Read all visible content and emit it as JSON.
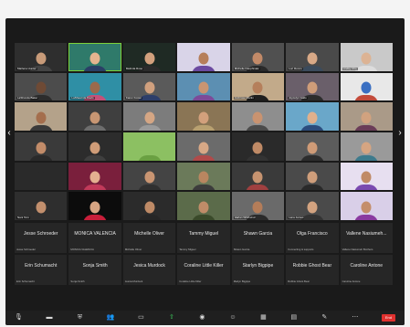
{
  "tiles": [
    {
      "name": "Marlena Hunter",
      "bg": "#2e2e2e",
      "skin": "#c89b79",
      "shirt": "#444444"
    },
    {
      "name": "",
      "bg": "#2f7a6a",
      "skin": "#e5b48f",
      "shirt": "#2a3f66",
      "active": true
    },
    {
      "name": "Melinda Rose",
      "bg": "#1f2a24",
      "skin": "#d2a07d",
      "shirt": "#2b2b2b"
    },
    {
      "name": "",
      "bg": "#d9d4e8",
      "skin": "#b67e5a",
      "shirt": "#6b4aa0"
    },
    {
      "name": "Michelle Dauphinais",
      "bg": "#505050",
      "skin": "#c28a68",
      "shirt": "#2a2a2a"
    },
    {
      "name": "Lori Ronco",
      "bg": "#4a4a4a",
      "skin": "#d8a987",
      "shirt": "#3b4b5c"
    },
    {
      "name": "Lindsy Cho",
      "bg": "#c9c9c9",
      "skin": "#dcb394",
      "shirt": "#dddddd"
    },
    {
      "name": "LaShonda Baker",
      "bg": "#4c4c4c",
      "skin": "#6e4a35",
      "shirt": "#2c2c2c"
    },
    {
      "name": "LaShawnda Davis",
      "bg": "#2f8fa5",
      "skin": "#9a6a4c",
      "shirt": "#c55078"
    },
    {
      "name": "Karen Foster",
      "bg": "#5a5a5a",
      "skin": "#d0a07e",
      "shirt": "#2d3e6a"
    },
    {
      "name": "",
      "bg": "#5c8fb2",
      "skin": "#c99572",
      "shirt": "#7d4a98"
    },
    {
      "name": "Ambrose Martin",
      "bg": "#c2aa8a",
      "skin": "#b57f5b",
      "shirt": "#1f1f1f"
    },
    {
      "name": "Joycelyn Gallo",
      "bg": "#6a5f6a",
      "skin": "#cf9d79",
      "shirt": "#2c2c2c"
    },
    {
      "name": "",
      "bg": "#e8e8e8",
      "skin": "#3a6fc2",
      "shirt": "#c24a3a"
    },
    {
      "name": "",
      "bg": "#b4a28a",
      "skin": "#a46e4d",
      "shirt": "#3a3a3a"
    },
    {
      "name": "",
      "bg": "#3f3f3f",
      "skin": "#c79673",
      "shirt": "#6d6d6d"
    },
    {
      "name": "",
      "bg": "#7c7c7c",
      "skin": "#d5a684",
      "shirt": "#9a9a9a"
    },
    {
      "name": "",
      "bg": "#8a7555",
      "skin": "#d2a07c",
      "shirt": "#b8a070"
    },
    {
      "name": "",
      "bg": "#8e8e8e",
      "skin": "#c99370",
      "shirt": "#4b4b4b"
    },
    {
      "name": "",
      "bg": "#6aa7c9",
      "skin": "#e0b08c",
      "shirt": "#2b4c7d"
    },
    {
      "name": "",
      "bg": "#aa9a88",
      "skin": "#d1a27f",
      "shirt": "#6a3c58"
    },
    {
      "name": "",
      "bg": "#3a3a3a",
      "skin": "#c28c69",
      "shirt": "#2a2a2a"
    },
    {
      "name": "",
      "bg": "#2c2c2c",
      "skin": "#cf9c78",
      "shirt": "#3f3f3f"
    },
    {
      "name": "",
      "bg": "#8cc062",
      "skin": "#8cc062",
      "shirt": "#6aa042"
    },
    {
      "name": "",
      "bg": "#6b6b6b",
      "skin": "#d7a886",
      "shirt": "#b04a4a"
    },
    {
      "name": "",
      "bg": "#2a2a2a",
      "skin": "#bf8a66",
      "shirt": "#333333"
    },
    {
      "name": "",
      "bg": "#5c5c5c",
      "skin": "#cf9b77",
      "shirt": "#2d2d2d"
    },
    {
      "name": "",
      "bg": "#9a9a9a",
      "skin": "#d6a582",
      "shirt": "#3d7a8c"
    },
    {
      "name": "",
      "bg": "#2a2a2a",
      "skin": "#2a2a2a",
      "shirt": "#2a2a2a"
    },
    {
      "name": "",
      "bg": "#7a1f3c",
      "skin": "#e4b090",
      "shirt": "#c23a5a"
    },
    {
      "name": "",
      "bg": "#444444",
      "skin": "#c99572",
      "shirt": "#303030"
    },
    {
      "name": "",
      "bg": "#6b7a5a",
      "skin": "#b98660",
      "shirt": "#3c3c3c"
    },
    {
      "name": "",
      "bg": "#3a3a3a",
      "skin": "#c69370",
      "shirt": "#a04040"
    },
    {
      "name": "",
      "bg": "#4a4a4a",
      "skin": "#cf9e7b",
      "shirt": "#2a2a2a"
    },
    {
      "name": "",
      "bg": "#e7dff0",
      "skin": "#c08a66",
      "shirt": "#7a4ab0"
    },
    {
      "name": "Nani Torn",
      "bg": "#2e2e2e",
      "skin": "#c28f6d",
      "shirt": "#2e2e2e"
    },
    {
      "name": "",
      "bg": "#0c0c0c",
      "skin": "#d7a583",
      "shirt": "#c81e3a"
    },
    {
      "name": "",
      "bg": "#2b2b2b",
      "skin": "#be8a66",
      "shirt": "#262626"
    },
    {
      "name": "",
      "bg": "#5b6b4a",
      "skin": "#c08c68",
      "shirt": "#3a4a2a"
    },
    {
      "name": "Harlan Whirlwind",
      "bg": "#6a6a6a",
      "skin": "#b47d59",
      "shirt": "#2a2a2a"
    },
    {
      "name": "Lana James",
      "bg": "#4a4a4a",
      "skin": "#d3a380",
      "shirt": "#333333"
    },
    {
      "name": "",
      "bg": "#d9cfe8",
      "skin": "#c48e6b",
      "shirt": "#8a3aa0"
    }
  ],
  "name_tiles": [
    {
      "display": "Jesse Schroeder",
      "small": "Jesse Schroeder"
    },
    {
      "display": "MONICA VALENCIA",
      "small": "MONICA VALENCIA"
    },
    {
      "display": "Michelle Oliver",
      "small": "Michelle Oliver"
    },
    {
      "display": "Tammy Miguel",
      "small": "Tammy Miguel"
    },
    {
      "display": "Shawn Garcia",
      "small": "Shawn Garcia"
    },
    {
      "display": "Olga Francisco",
      "small": "Connecting & supports"
    },
    {
      "display": "Vallene Nasiumeh...",
      "small": "Vallene Nasiumeh Brothers"
    },
    {
      "display": "Erin Schumacht",
      "small": "Erin Schumacht"
    },
    {
      "display": "Sonja Smith",
      "small": "Sonja Smith"
    },
    {
      "display": "Jesica Murdock",
      "small": "Jesica Murdock"
    },
    {
      "display": "Coraline Little Killer",
      "small": "Coraline Little Killer"
    },
    {
      "display": "Starlyn Bigpipe",
      "small": "Marlyn Bigpipe"
    },
    {
      "display": "Robbie Ghost Bear",
      "small": "Robbie Ghost Bear"
    },
    {
      "display": "Caroline Antone",
      "small": "Caroline Antone"
    }
  ],
  "toolbar": {
    "items": [
      {
        "icon": "microphone-icon",
        "glyph": "🎙"
      },
      {
        "icon": "video-camera-icon",
        "glyph": "▬"
      },
      {
        "icon": "security-icon",
        "glyph": "⛨"
      },
      {
        "icon": "participants-icon",
        "glyph": "👥"
      },
      {
        "icon": "chat-icon",
        "glyph": "▭"
      },
      {
        "icon": "share-screen-icon",
        "glyph": "⇧",
        "green": true
      },
      {
        "icon": "record-icon",
        "glyph": "◉"
      },
      {
        "icon": "reactions-icon",
        "glyph": "☺"
      },
      {
        "icon": "apps-icon",
        "glyph": "▦"
      },
      {
        "icon": "whiteboards-icon",
        "glyph": "▤"
      },
      {
        "icon": "notes-icon",
        "glyph": "✎"
      },
      {
        "icon": "more-icon",
        "glyph": "⋯"
      }
    ],
    "end_label": "End"
  },
  "colors": {
    "window_bg": "#1a1a1a",
    "end_red": "#e0312f",
    "active_green": "#7cd23a"
  }
}
